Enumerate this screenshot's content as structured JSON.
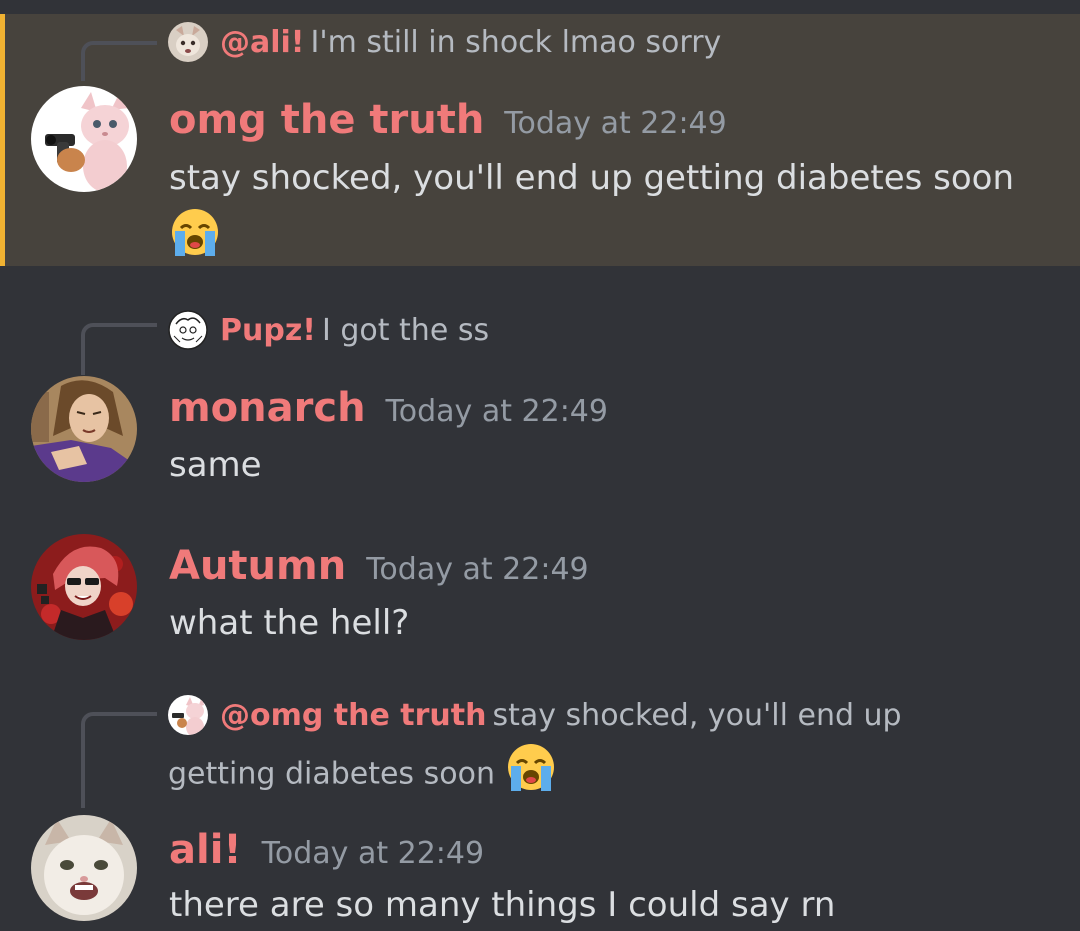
{
  "colors": {
    "background": "#313338",
    "highlight_background": "#47433d",
    "highlight_bar": "#f0b232",
    "author": "#f07a7a",
    "timestamp": "#949ba4",
    "message_text": "#dbdee1",
    "reply_text": "#b5bac1"
  },
  "messages": [
    {
      "highlighted": true,
      "reply": {
        "author": "@ali!",
        "text": "I'm still in shock lmao sorry",
        "avatar_icon": "cat-avatar-icon"
      },
      "author": "omg the truth",
      "timestamp": "Today at 22:49",
      "text": "stay shocked, you'll end up getting diabetes soon",
      "emoji": "loudly-crying-face-emoji",
      "avatar_icon": "sphynx-cat-with-gun-avatar"
    },
    {
      "highlighted": false,
      "reply": {
        "author": "Pupz!",
        "text": "I got the ss",
        "avatar_icon": "sketch-avatar-icon"
      },
      "author": "monarch",
      "timestamp": "Today at 22:49",
      "text": "same",
      "avatar_icon": "anime-character-avatar"
    },
    {
      "highlighted": false,
      "author": "Autumn",
      "timestamp": "Today at 22:49",
      "text": "what the hell?",
      "avatar_icon": "red-haired-character-avatar"
    },
    {
      "highlighted": false,
      "reply": {
        "author": "@omg the truth",
        "text": "stay shocked, you'll end up getting diabetes soon",
        "emoji": "loudly-crying-face-emoji",
        "avatar_icon": "sphynx-cat-avatar-icon"
      },
      "author": "ali!",
      "timestamp": "Today at 22:49",
      "text": "there are so many things I could say rn",
      "avatar_icon": "white-cat-avatar"
    }
  ]
}
